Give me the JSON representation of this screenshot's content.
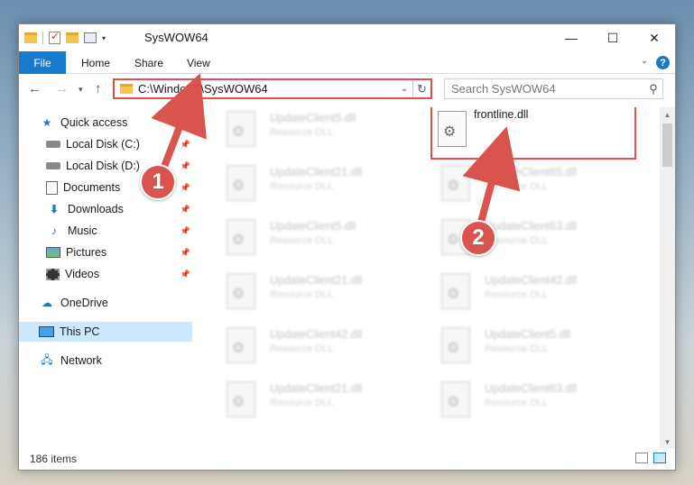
{
  "window": {
    "title": "SysWOW64",
    "controls": {
      "minimize": "—",
      "maximize": "☐",
      "close": "✕"
    }
  },
  "ribbon": {
    "tabs": {
      "file": "File",
      "home": "Home",
      "share": "Share",
      "view": "View"
    },
    "help": "?"
  },
  "navigation": {
    "address": "C:\\Windows\\SysWOW64",
    "search_placeholder": "Search SysWOW64"
  },
  "sidebar": {
    "quick_access": "Quick access",
    "items": [
      {
        "label": "Local Disk (C:)",
        "icon": "drive-icon"
      },
      {
        "label": "Local Disk (D:)",
        "icon": "drive-icon"
      },
      {
        "label": "Documents",
        "icon": "documents-icon"
      },
      {
        "label": "Downloads",
        "icon": "downloads-icon"
      },
      {
        "label": "Music",
        "icon": "music-icon"
      },
      {
        "label": "Pictures",
        "icon": "pictures-icon"
      },
      {
        "label": "Videos",
        "icon": "videos-icon"
      }
    ],
    "onedrive": "OneDrive",
    "this_pc": "This PC",
    "network": "Network"
  },
  "files": {
    "left": [
      {
        "name": "UpdateClient5.dll",
        "type": "Resource DLL"
      },
      {
        "name": "UpdateClient21.dll",
        "type": "Resource DLL"
      },
      {
        "name": "UpdateClient5.dll",
        "type": "Resource DLL"
      },
      {
        "name": "UpdateClient21.dll",
        "type": "Resource DLL"
      },
      {
        "name": "UpdateClient42.dll",
        "type": "Resource DLL"
      },
      {
        "name": "UpdateClient21.dll",
        "type": "Resource DLL"
      }
    ],
    "highlighted": {
      "name": "frontline.dll"
    },
    "right": [
      {
        "name": "UpdateClient65.dll",
        "type": "Resource DLL"
      },
      {
        "name": "UpdateClient63.dll",
        "type": "Resource DLL"
      },
      {
        "name": "UpdateClient42.dll",
        "type": "Resource DLL"
      },
      {
        "name": "UpdateClient5.dll",
        "type": "Resource DLL"
      },
      {
        "name": "UpdateClient63.dll",
        "type": "Resource DLL"
      }
    ]
  },
  "status": {
    "count": "186 items"
  },
  "callouts": {
    "step1": "1",
    "step2": "2"
  },
  "colors": {
    "accent": "#1979ca",
    "highlight": "#d9534f",
    "selected": "#cce8ff"
  }
}
